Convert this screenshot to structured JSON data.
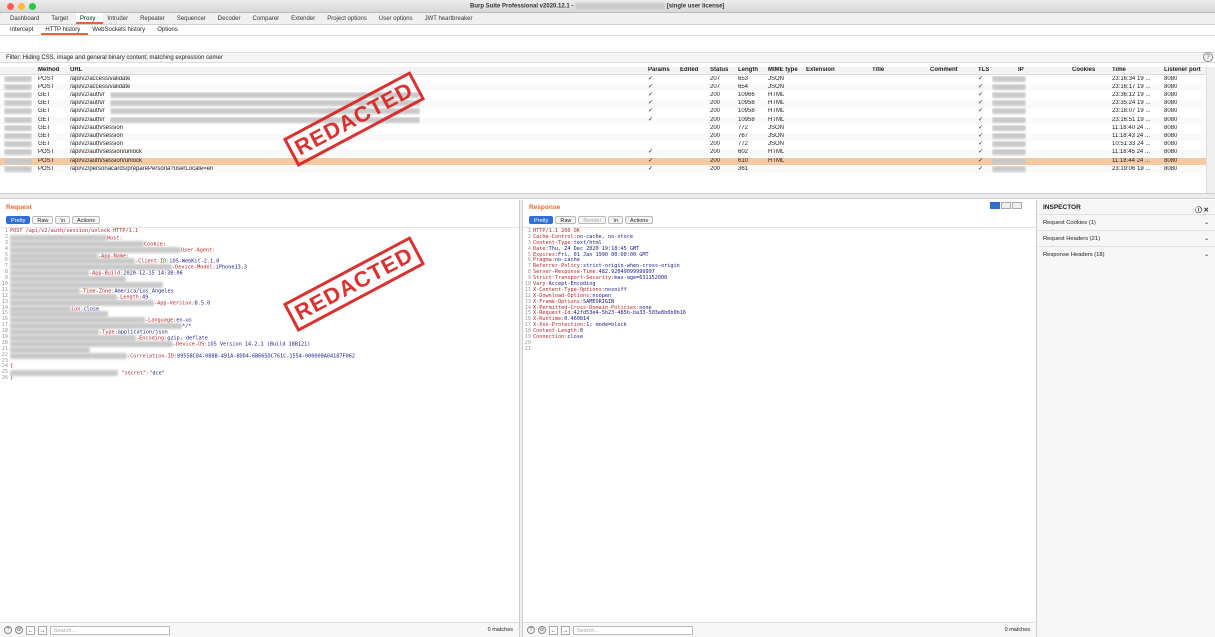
{
  "window": {
    "title": "Burp Suite Professional v2020.12.1 -",
    "title_suffix": "[single user license]"
  },
  "main_tabs": [
    "Dashboard",
    "Target",
    "Proxy",
    "Intruder",
    "Repeater",
    "Sequencer",
    "Decoder",
    "Comparer",
    "Extender",
    "Project options",
    "User options",
    "JWT heartbreaker"
  ],
  "sub_tabs": [
    "Intercept",
    "HTTP history",
    "WebSockets history",
    "Options"
  ],
  "filter": "Filter: Hiding CSS, image and general binary content;  matching expression cemer",
  "help_glyph": "?",
  "table": {
    "headers": [
      "Method",
      "URL",
      "Params",
      "Edited",
      "Status",
      "Length",
      "MIME type",
      "Extension",
      "Title",
      "Comment",
      "TLS",
      "IP",
      "Cookies",
      "Time",
      "Listener port"
    ],
    "rows": [
      {
        "method": "POST",
        "url": "/api/v2/access/validate",
        "params": "✓",
        "status": "207",
        "length": "653",
        "mime": "JSON",
        "tls": "✓",
        "time": "23:16:34 19 ...",
        "port": "8080"
      },
      {
        "method": "POST",
        "url": "/api/v2/access/validate",
        "params": "✓",
        "status": "207",
        "length": "654",
        "mime": "JSON",
        "tls": "✓",
        "time": "23:16:17 19 ...",
        "port": "8080"
      },
      {
        "method": "GET",
        "url": "/api/v2/auth/r",
        "params": "✓",
        "status": "200",
        "length": "10966",
        "mime": "HTML",
        "tls": "✓",
        "time": "23:36:12 19 ...",
        "port": "8080"
      },
      {
        "method": "GET",
        "url": "/api/v2/auth/r",
        "params": "✓",
        "status": "200",
        "length": "10958",
        "mime": "HTML",
        "tls": "✓",
        "time": "23:35:24 19 ...",
        "port": "8080"
      },
      {
        "method": "GET",
        "url": "/api/v2/auth/r",
        "params": "✓",
        "status": "200",
        "length": "10958",
        "mime": "HTML",
        "tls": "✓",
        "time": "23:18:07 19 ...",
        "port": "8080"
      },
      {
        "method": "GET",
        "url": "/api/v2/auth/r",
        "params": "✓",
        "status": "200",
        "length": "10958",
        "mime": "HTML",
        "tls": "✓",
        "time": "23:16:51 19 ...",
        "port": "8080"
      },
      {
        "method": "GET",
        "url": "/api/v2/auth/session",
        "params": "",
        "status": "200",
        "length": "772",
        "mime": "JSON",
        "tls": "✓",
        "time": "11:18:40 24 ...",
        "port": "8080"
      },
      {
        "method": "GET",
        "url": "/api/v2/auth/session",
        "params": "",
        "status": "200",
        "length": "767",
        "mime": "JSON",
        "tls": "✓",
        "time": "11:18:43 24 ...",
        "port": "8080"
      },
      {
        "method": "GET",
        "url": "/api/v2/auth/session",
        "params": "",
        "status": "200",
        "length": "772",
        "mime": "JSON",
        "tls": "✓",
        "time": "10:51:33 24 ...",
        "port": "8080"
      },
      {
        "method": "POST",
        "url": "/api/v2/auth/session/unlock",
        "params": "✓",
        "status": "200",
        "length": "602",
        "mime": "HTML",
        "tls": "✓",
        "time": "11:18:45 24 ...",
        "port": "8080"
      },
      {
        "method": "POST",
        "url": "/api/v2/auth/session/unlock",
        "params": "✓",
        "status": "200",
        "length": "610",
        "mime": "HTML",
        "tls": "✓",
        "time": "11:18:44 24 ...",
        "port": "8080",
        "selected": true
      },
      {
        "method": "POST",
        "url": "/api/v2/personacards/preparePersona?userLocale=en",
        "params": "✓",
        "status": "200",
        "length": "361",
        "mime": "",
        "tls": "✓",
        "time": "23:19:06 19 ...",
        "port": "8080"
      }
    ]
  },
  "request": {
    "title": "Request",
    "tabs": [
      "Pretty",
      "Raw",
      "\\n",
      "Actions"
    ],
    "lines": [
      {
        "h": "POST /api/v2/auth/session/unlock HTTP/1.1",
        "v": ""
      },
      {
        "h": "Host:",
        "v": ""
      },
      {
        "h": "Cookie:",
        "v": ""
      },
      {
        "h": "User-Agent:",
        "v": ""
      },
      {
        "h": "-App-Name:",
        "v": ""
      },
      {
        "h": "-Client-ID:",
        "v": "iOS-WebKit-2.1.0"
      },
      {
        "h": "-Device-Model:",
        "v": "iPhone13,3"
      },
      {
        "h": "-App-Build:",
        "v": "2020-12-15 14:38:06"
      },
      {
        "h": "",
        "v": ""
      },
      {
        "h": "",
        "v": ""
      },
      {
        "h": "-Time-Zone:",
        "v": "America/Los_Angeles"
      },
      {
        "h": "-Length:",
        "v": "49"
      },
      {
        "h": "-App-Version:",
        "v": "8.5.0"
      },
      {
        "h": "ion:",
        "v": "close"
      },
      {
        "h": "",
        "v": ""
      },
      {
        "h": "-Language:",
        "v": "en-us"
      },
      {
        "h": "",
        "v": "*/*"
      },
      {
        "h": "-Type:",
        "v": "application/json"
      },
      {
        "h": "-Encoding:",
        "v": "gzip, deflate"
      },
      {
        "h": "-Device-OS:",
        "v": "iOS Version 14.2.1 (Build 18B121)"
      },
      {
        "h": "",
        "v": ""
      },
      {
        "h": "-Correlation-ID:",
        "v": "8955BC84-088B-491A-8DD4-6B665DC761C-1554-000000A04187F062"
      },
      {
        "h": "",
        "v": ""
      },
      {
        "h": "{",
        "v": ""
      },
      {
        "h": "  \"secret\":\"",
        "v": "dce\""
      },
      {
        "h": "}",
        "v": ""
      }
    ],
    "search_placeholder": "Search...",
    "matches": "0 matches"
  },
  "response": {
    "title": "Response",
    "tabs": [
      "Pretty",
      "Raw",
      "Render",
      "\\n",
      "Actions"
    ],
    "lines": [
      {
        "h": "HTTP/1.1 200 OK",
        "v": ""
      },
      {
        "h": "Cache-Control:",
        "v": "no-cache, no-store"
      },
      {
        "h": "Content-Type:",
        "v": "text/html"
      },
      {
        "h": "Date:",
        "v": "Thu, 24 Dec 2020 19:18:45 GMT"
      },
      {
        "h": "Expires:",
        "v": "Fri, 01 Jan 1990 00:00:00 GMT"
      },
      {
        "h": "Pragma:",
        "v": "no-cache"
      },
      {
        "h": "Referrer-Policy:",
        "v": "strict-origin-when-cross-origin"
      },
      {
        "h": "Server-Response-Time:",
        "v": "482.92049099999997"
      },
      {
        "h": "Strict-Transport-Security:",
        "v": "max-age=631152000"
      },
      {
        "h": "Vary:",
        "v": "Accept-Encoding"
      },
      {
        "h": "X-Content-Type-Options:",
        "v": "nosniff"
      },
      {
        "h": "X-Download-Options:",
        "v": "noopen"
      },
      {
        "h": "X-Frame-Options:",
        "v": "SAMEORIGIN"
      },
      {
        "h": "X-Permitted-Cross-Domain-Policies:",
        "v": "none"
      },
      {
        "h": "X-Request-Id:",
        "v": "42fd53e4-5b23-485b-ba33-503e8b0b0b16"
      },
      {
        "h": "X-Runtime:",
        "v": "0.460814"
      },
      {
        "h": "X-Xss-Protection:",
        "v": "1; mode=block"
      },
      {
        "h": "Content-Length:",
        "v": "0"
      },
      {
        "h": "Connection:",
        "v": "close"
      },
      {
        "h": "",
        "v": ""
      },
      {
        "h": "",
        "v": ""
      }
    ],
    "search_placeholder": "Search...",
    "matches": "0 matches"
  },
  "inspector": {
    "title": "INSPECTOR",
    "sections": [
      "Request Cookies (1)",
      "Request Headers (21)",
      "Response Headers (18)"
    ]
  },
  "stamp_text": "REDACTED",
  "colors": {
    "accent": "#e8652c",
    "selected_row": "#f7c9a3",
    "stamp": "#d82020",
    "toggle_on": "#2d6fd6"
  }
}
